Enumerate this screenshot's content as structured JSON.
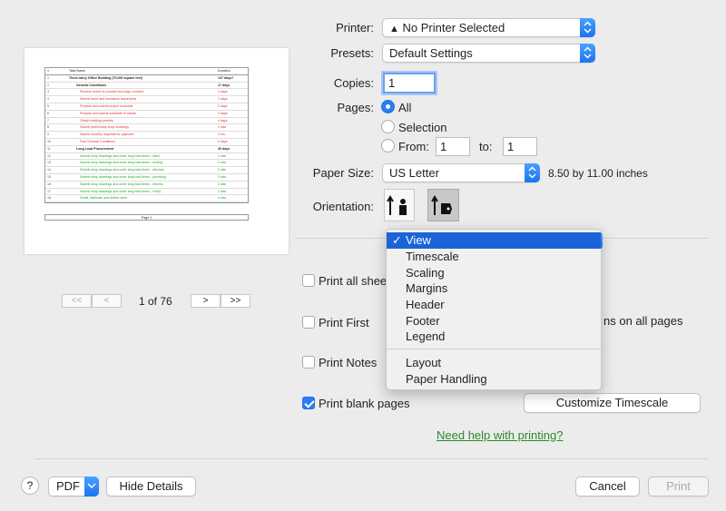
{
  "printer": {
    "label": "Printer:",
    "value": "No Printer Selected"
  },
  "presets": {
    "label": "Presets:",
    "value": "Default Settings"
  },
  "copies": {
    "label": "Copies:",
    "value": "1"
  },
  "pages": {
    "label": "Pages:",
    "all": "All",
    "selection": "Selection",
    "from": "From:",
    "from_value": "1",
    "to": "to:",
    "to_value": "1"
  },
  "paper": {
    "label": "Paper Size:",
    "value": "US Letter",
    "dims": "8.50 by 11.00 inches"
  },
  "orientation": {
    "label": "Orientation:"
  },
  "menu": {
    "items": [
      "View",
      "Timescale",
      "Scaling",
      "Margins",
      "Header",
      "Footer",
      "Legend"
    ],
    "items2": [
      "Layout",
      "Paper Handling"
    ],
    "selected": "View"
  },
  "options": {
    "print_all_sheets": "Print all shee",
    "print_first": "Print First",
    "print_notes": "Print Notes",
    "print_blank": "Print blank pages",
    "columns_all_pages": "ns on all pages",
    "customize_timescale": "Customize Timescale"
  },
  "help_link": "Need help with printing?",
  "pager": {
    "first": "<<",
    "prev": "<",
    "text": "1 of 76",
    "next": ">",
    "last": ">>"
  },
  "footer": {
    "help": "?",
    "pdf": "PDF",
    "hide_details": "Hide Details",
    "cancel": "Cancel",
    "print": "Print"
  },
  "preview": {
    "header": {
      "name": "Task Name",
      "duration": "Duration"
    },
    "rows": [
      {
        "id": "1",
        "name": "Three-story Office Building (76,000 square feet)",
        "duration": "147 days?",
        "style": "bold"
      },
      {
        "id": "2",
        "name": "General Conditions",
        "duration": "17 days",
        "style": "bold"
      },
      {
        "id": "3",
        "name": "Receive notice to proceed and sign contract",
        "duration": "3 days",
        "style": "red"
      },
      {
        "id": "4",
        "name": "Submit bond and insurance documents",
        "duration": "2 days",
        "style": "red"
      },
      {
        "id": "5",
        "name": "Prepare and submit project schedule",
        "duration": "2 days",
        "style": "red"
      },
      {
        "id": "6",
        "name": "Prepare and submit schedule of values",
        "duration": "2 days",
        "style": "red"
      },
      {
        "id": "7",
        "name": "Obtain building permits",
        "duration": "4 days",
        "style": "red"
      },
      {
        "id": "8",
        "name": "Submit preliminary shop drawings",
        "duration": "2 wks",
        "style": "red"
      },
      {
        "id": "9",
        "name": "Submit monthly requests for payment",
        "duration": "4 ms",
        "style": "red"
      },
      {
        "id": "10",
        "name": "Post General Conditions",
        "duration": "0 days",
        "style": "red"
      },
      {
        "id": "11",
        "name": "Long Lead Procurement",
        "duration": "30 days",
        "style": "bold"
      },
      {
        "id": "12",
        "name": "Submit shop drawings and order long lead items - steel",
        "duration": "2 wks",
        "style": "green"
      },
      {
        "id": "13",
        "name": "Submit shop drawings and order long lead items - roofing",
        "duration": "2 wks",
        "style": "green"
      },
      {
        "id": "14",
        "name": "Submit shop drawings and order long lead items - elevator",
        "duration": "2 wks",
        "style": "green"
      },
      {
        "id": "15",
        "name": "Submit shop drawings and order long lead items - plumbing",
        "duration": "2 wks",
        "style": "green"
      },
      {
        "id": "16",
        "name": "Submit shop drawings and order long lead items - electric",
        "duration": "2 wks",
        "style": "green"
      },
      {
        "id": "17",
        "name": "Submit shop drawings and order long lead items - HVAC",
        "duration": "2 wks",
        "style": "green"
      },
      {
        "id": "18",
        "name": "Detail, fabricate and deliver steel",
        "duration": "4 wks",
        "style": "green"
      }
    ],
    "footer": "Page 1"
  },
  "colors": {
    "accent": "#1a74f0",
    "link": "#2a8a2a",
    "menu_selected": "#1a64d8"
  }
}
